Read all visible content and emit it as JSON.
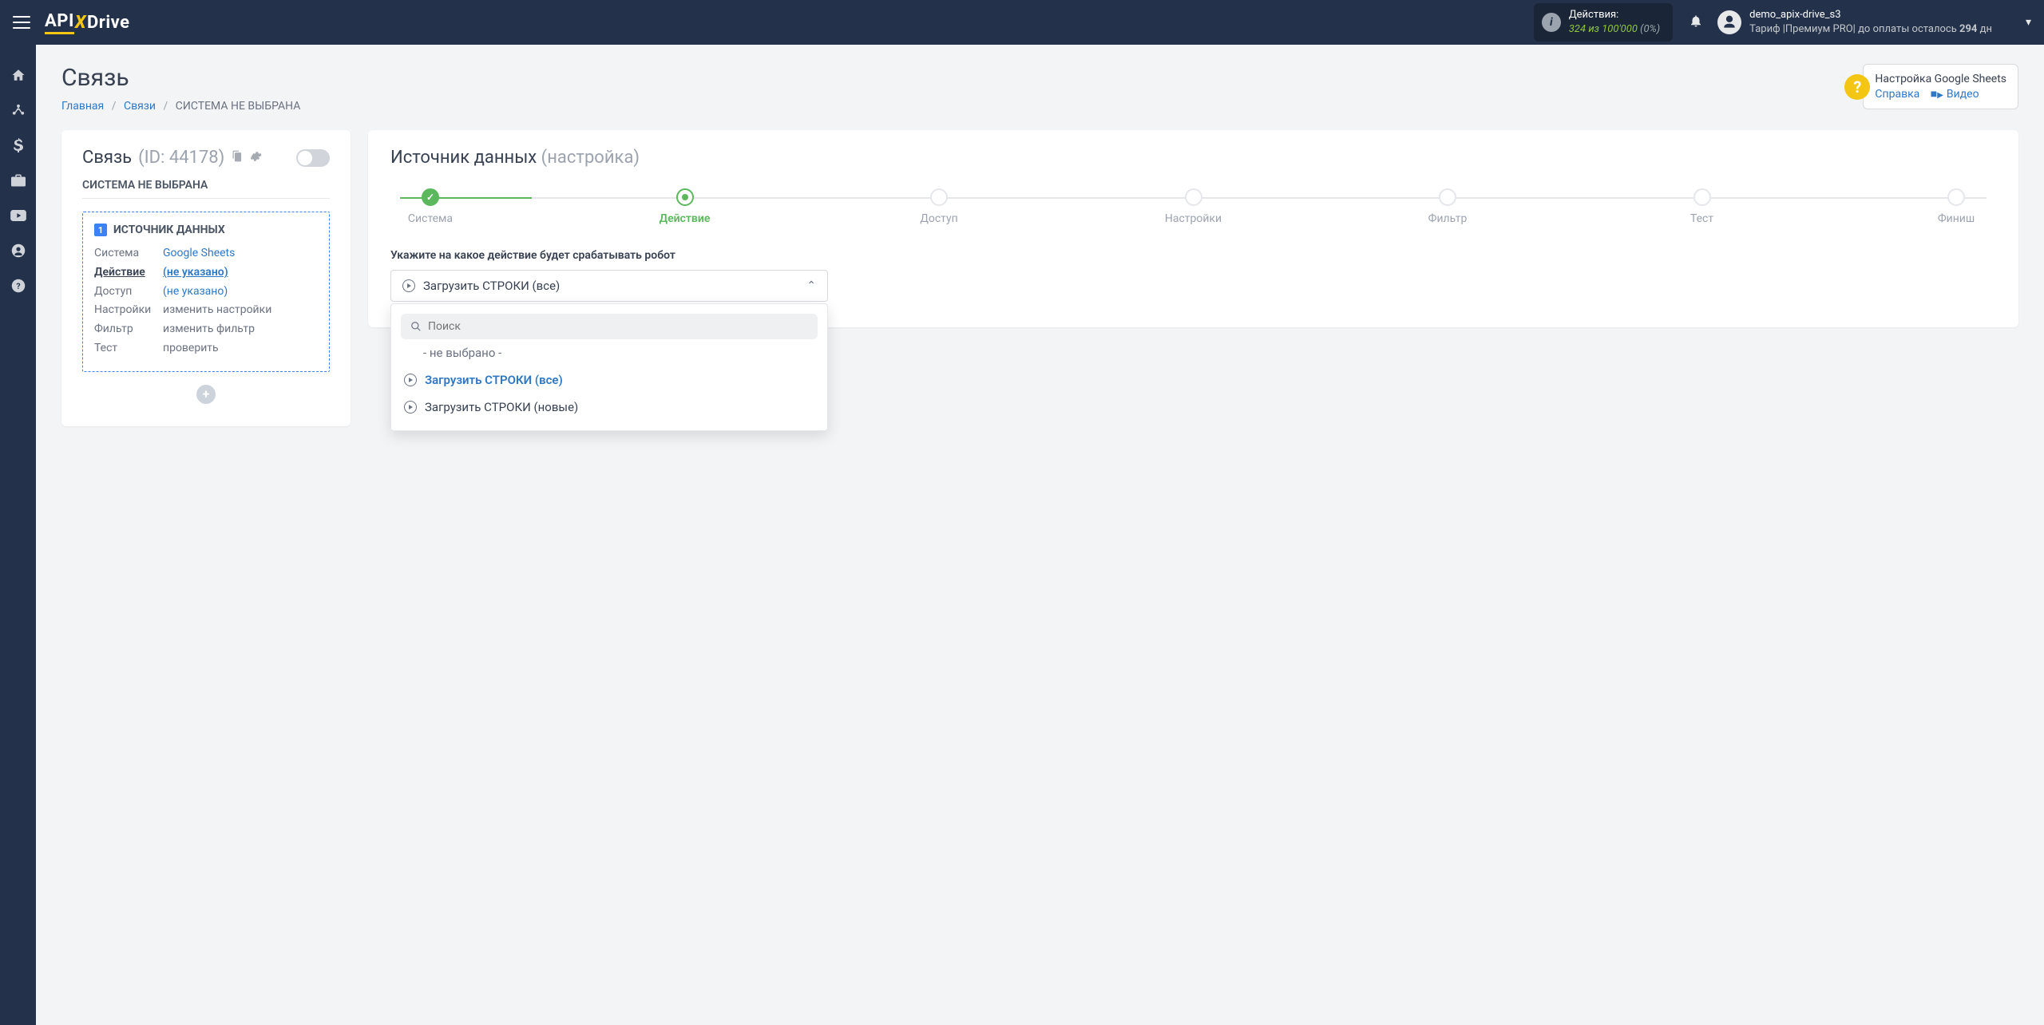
{
  "header": {
    "actions_label": "Действия:",
    "actions_used": "324",
    "actions_of": "из",
    "actions_total": "100'000",
    "actions_pct": "(0%)",
    "username": "demo_apix-drive_s3",
    "tariff_line_prefix": "Тариф |Премиум PRO| до оплаты осталось ",
    "days_left": "294",
    "days_suffix": " дн"
  },
  "page": {
    "title": "Связь",
    "breadcrumbs": {
      "home": "Главная",
      "connections": "Связи",
      "current": "СИСТЕМА НЕ ВЫБРАНА"
    },
    "help": {
      "title": "Настройка Google Sheets",
      "link_help": "Справка",
      "link_video": "Видео"
    }
  },
  "left": {
    "title": "Связь",
    "id": "(ID: 44178)",
    "subtitle": "СИСТЕМА НЕ ВЫБРАНА",
    "box_title": "ИСТОЧНИК ДАННЫХ",
    "rows": {
      "system_k": "Система",
      "system_v": "Google Sheets",
      "action_k": "Действие",
      "action_v": "(не указано)",
      "access_k": "Доступ",
      "access_v": "(не указано)",
      "settings_k": "Настройки",
      "settings_v": "изменить настройки",
      "filter_k": "Фильтр",
      "filter_v": "изменить фильтр",
      "test_k": "Тест",
      "test_v": "проверить"
    }
  },
  "right": {
    "title": "Источник данных",
    "title_sub": "(настройка)",
    "steps": [
      "Система",
      "Действие",
      "Доступ",
      "Настройки",
      "Фильтр",
      "Тест",
      "Финиш"
    ],
    "field_label": "Укажите на какое действие будет срабатывать робот",
    "selected": "Загрузить СТРОКИ (все)",
    "search_placeholder": "Поиск",
    "options": {
      "none": "- не выбрано -",
      "all": "Загрузить СТРОКИ (все)",
      "new": "Загрузить СТРОКИ (новые)"
    }
  }
}
